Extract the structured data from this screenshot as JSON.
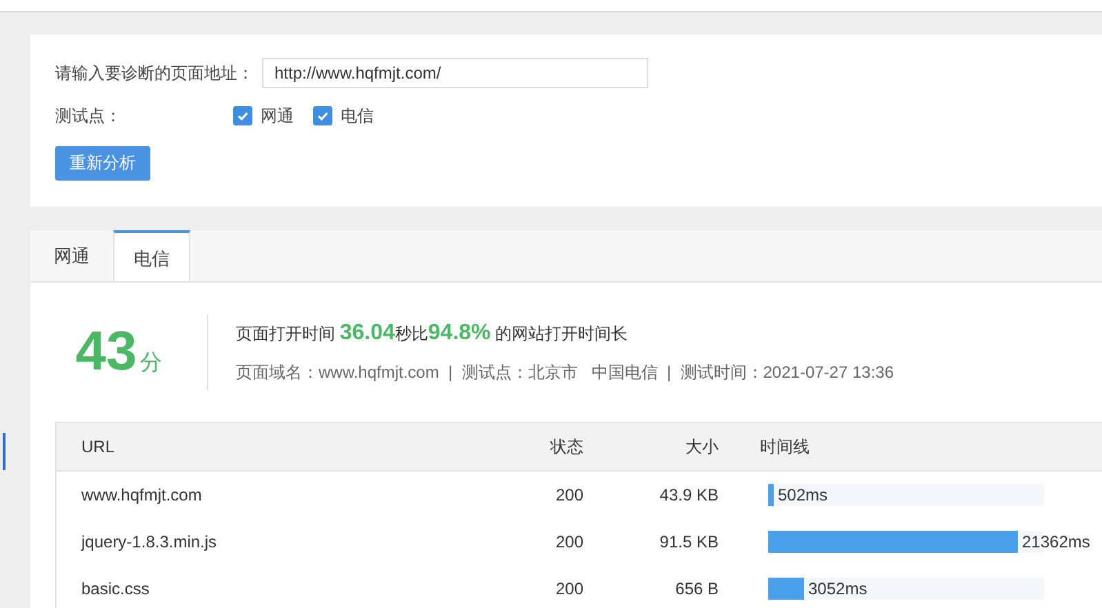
{
  "form": {
    "url_label": "请输入要诊断的页面地址：",
    "url_value": "http://www.hqfmjt.com/",
    "nodes_label": "测试点：",
    "nodes": [
      {
        "label": "网通",
        "checked": true
      },
      {
        "label": "电信",
        "checked": true
      }
    ],
    "submit": "重新分析"
  },
  "tabs": [
    {
      "label": "网通",
      "selected": false
    },
    {
      "label": "电信",
      "selected": true
    }
  ],
  "score": {
    "value": "43",
    "unit": "分",
    "summary": "页面打开时间 **36.04**秒比**94.8%** 的网站打开时间长",
    "details": "页面域名：www.hqfmjt.com  |  测试点：北京市   中国电信  |  测试时间：2021-07-27 13:36"
  },
  "table": {
    "columns": [
      "URL",
      "状态",
      "大小",
      "时间线"
    ],
    "rows": [
      {
        "url": "www.hqfmjt.com",
        "status": "200",
        "size": "43.9 KB",
        "time": "502ms",
        "level": 0.02
      },
      {
        "url": "jquery-1.8.3.min.js",
        "status": "200",
        "size": "91.5 KB",
        "time": "21362ms",
        "level": 0.905
      },
      {
        "url": "basic.css",
        "status": "200",
        "size": "656 B",
        "time": "3052ms",
        "level": 0.13
      }
    ]
  }
}
